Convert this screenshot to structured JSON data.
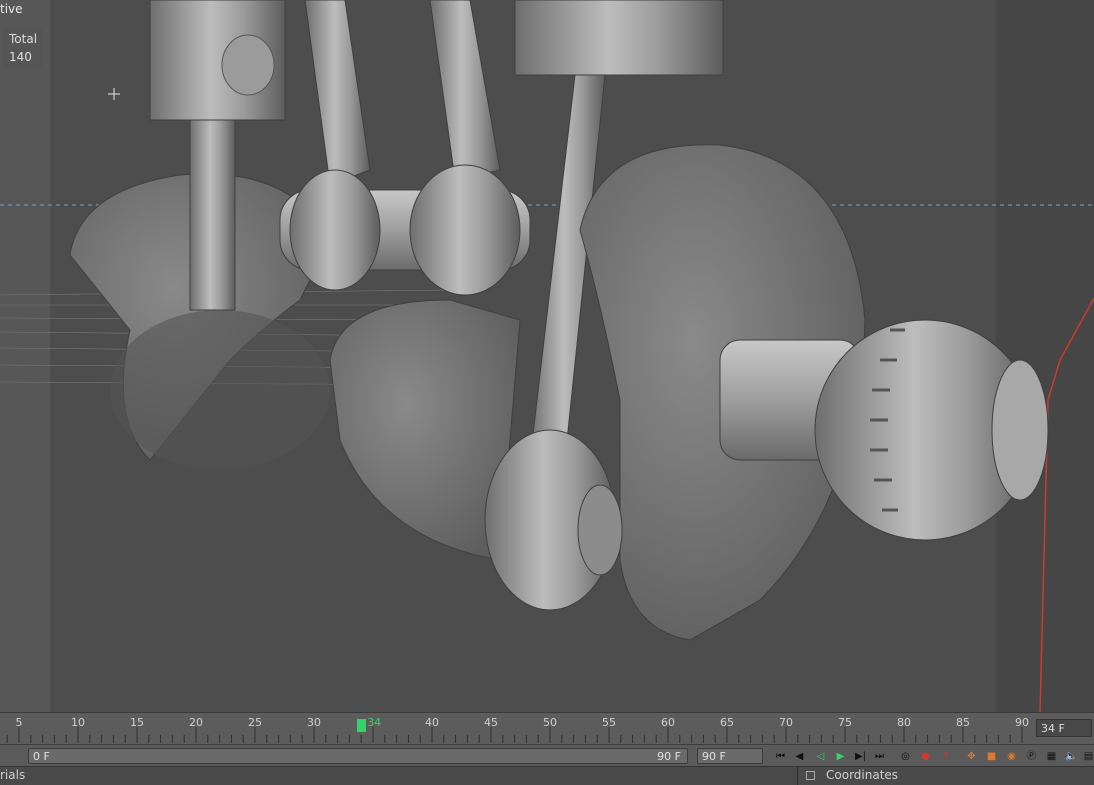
{
  "viewport": {
    "label": "tive",
    "stats_title": "Total",
    "stats_value": "140"
  },
  "timeline": {
    "ticks": [
      "5",
      "10",
      "15",
      "20",
      "25",
      "30",
      "34",
      "40",
      "45",
      "50",
      "55",
      "60",
      "65",
      "70",
      "75",
      "80",
      "85",
      "90"
    ],
    "current_tick": "34",
    "frame_readout": "34 F"
  },
  "controls": {
    "start_field": "0 F",
    "end_field": "90 F",
    "fps_field": "90 F"
  },
  "bottombar": {
    "left_tab": "rials",
    "right_tab": "Coordinates"
  },
  "colors": {
    "accent": "#39d16b",
    "key_orange": "#e0782a",
    "red": "#cc3b2b"
  }
}
